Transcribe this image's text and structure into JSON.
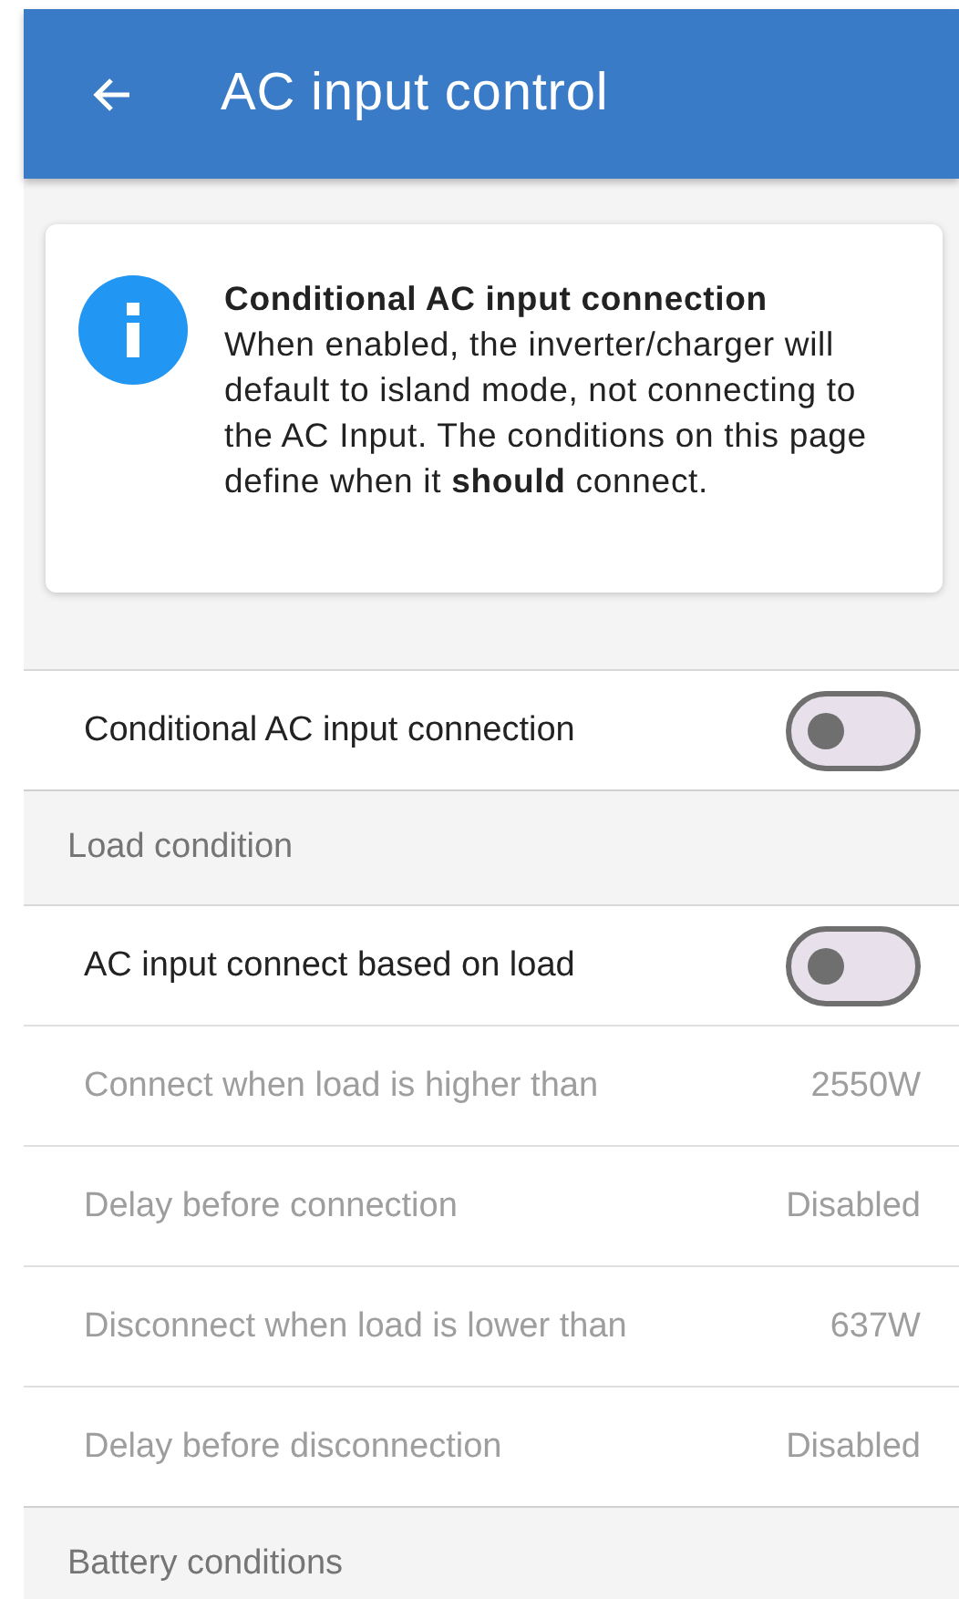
{
  "header": {
    "title": "AC input control"
  },
  "info_card": {
    "title": "Conditional AC input connection",
    "text": "When enabled, the inverter/charger will default to island mode, not connecting to the AC Input. The conditions on this page define when it **should** connect."
  },
  "settings": [
    {
      "kind": "toggle",
      "label": "Conditional AC input connection",
      "on": false
    },
    {
      "kind": "section",
      "label": "Load condition"
    },
    {
      "kind": "toggle",
      "label": "AC input connect based on load",
      "on": false
    },
    {
      "kind": "value",
      "label": "Connect when load is higher than",
      "value": "2550W",
      "disabled": true
    },
    {
      "kind": "value",
      "label": "Delay before connection",
      "value": "Disabled",
      "disabled": true
    },
    {
      "kind": "value",
      "label": "Disconnect when load is lower than",
      "value": "637W",
      "disabled": true
    },
    {
      "kind": "value",
      "label": "Delay before disconnection",
      "value": "Disabled",
      "disabled": true
    },
    {
      "kind": "section",
      "label": "Battery conditions"
    }
  ]
}
